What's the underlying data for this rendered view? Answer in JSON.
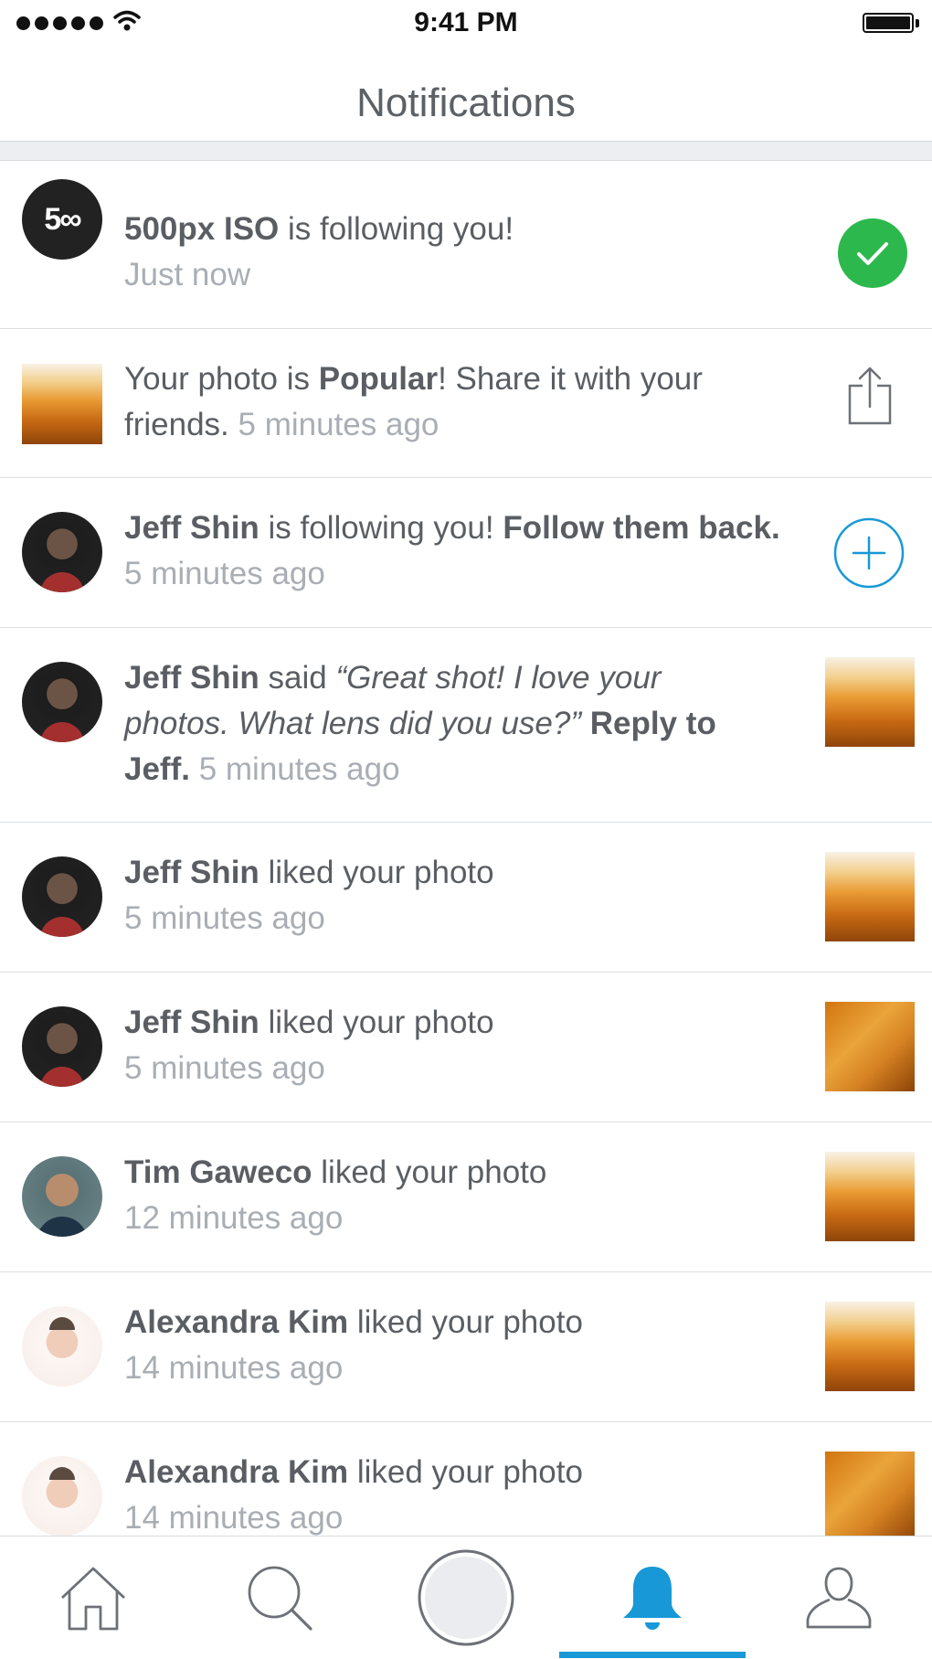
{
  "status_bar": {
    "time": "9:41 PM"
  },
  "nav": {
    "title": "Notifications"
  },
  "notifications": [
    {
      "avatar": "500px",
      "parts": [
        {
          "t": "500px ISO",
          "s": "bold"
        },
        {
          "t": " is following you!"
        }
      ],
      "time": "Just now",
      "time_break": true,
      "action": "check-circle-icon"
    },
    {
      "parts": [
        {
          "t": "Your photo is "
        },
        {
          "t": "Popular",
          "s": "bold"
        },
        {
          "t": "! Share it with your friends."
        }
      ],
      "time": "5 minutes ago",
      "action": "share-icon"
    },
    {
      "parts": [
        {
          "t": "Jeff Shin",
          "s": "bold"
        },
        {
          "t": " is following you! "
        },
        {
          "t": "Follow them back.",
          "s": "bold"
        }
      ],
      "time": "5 minutes ago",
      "action": "add-circle-icon"
    },
    {
      "parts": [
        {
          "t": "Jeff Shin",
          "s": "bold"
        },
        {
          "t": " said "
        },
        {
          "t": "“Great shot! I love your photos. What lens did you use?”",
          "s": "italic"
        },
        {
          "t": " "
        },
        {
          "t": "Reply to Jeff.",
          "s": "bold"
        }
      ],
      "time": "5 minutes ago"
    },
    {
      "parts": [
        {
          "t": "Jeff Shin",
          "s": "bold"
        },
        {
          "t": " liked your photo"
        }
      ],
      "time": "5 minutes ago",
      "time_break": true
    },
    {
      "parts": [
        {
          "t": "Jeff Shin",
          "s": "bold"
        },
        {
          "t": " liked your photo"
        }
      ],
      "time": "5 minutes ago",
      "time_break": true
    },
    {
      "parts": [
        {
          "t": "Tim Gaweco",
          "s": "bold"
        },
        {
          "t": " liked your photo"
        }
      ],
      "time": "12 minutes ago",
      "time_break": true
    },
    {
      "parts": [
        {
          "t": "Alexandra Kim",
          "s": "bold"
        },
        {
          "t": " liked your photo"
        }
      ],
      "time": "14 minutes ago",
      "time_break": true
    },
    {
      "parts": [
        {
          "t": "Alexandra Kim",
          "s": "bold"
        },
        {
          "t": " liked your photo"
        }
      ],
      "time": "14 minutes ago",
      "time_break": true
    }
  ],
  "tab_bar": {
    "tabs": [
      "home-icon",
      "search-icon",
      "upload-button",
      "notifications-bell-icon",
      "profile-icon"
    ],
    "active": "notifications-bell-icon"
  },
  "colors": {
    "accent": "#1898d6",
    "success": "#2db84d",
    "text": "#5a5e63",
    "muted": "#a9aeb4"
  }
}
